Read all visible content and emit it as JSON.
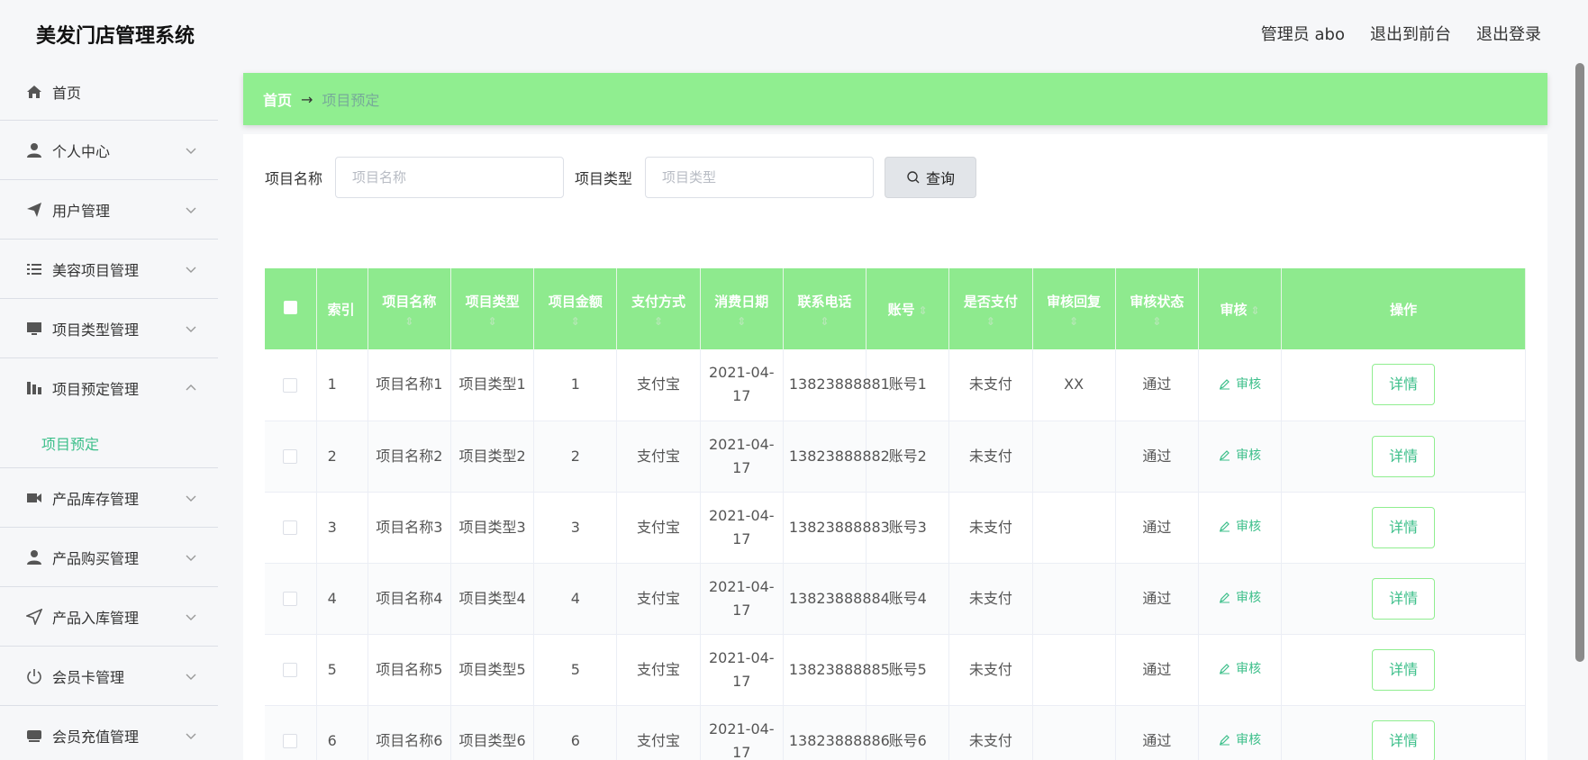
{
  "header": {
    "brand": "美发门店管理系统",
    "admin": "管理员 abo",
    "to_front": "退出到前台",
    "logout": "退出登录"
  },
  "sidebar": {
    "items": [
      {
        "label": "首页",
        "icon": "home-icon"
      },
      {
        "label": "个人中心",
        "icon": "user-icon"
      },
      {
        "label": "用户管理",
        "icon": "paper-plane-icon"
      },
      {
        "label": "美容项目管理",
        "icon": "list-icon"
      },
      {
        "label": "项目类型管理",
        "icon": "monitor-icon"
      },
      {
        "label": "项目预定管理",
        "icon": "chart-icon"
      },
      {
        "label": "产品库存管理",
        "icon": "video-icon"
      },
      {
        "label": "产品购买管理",
        "icon": "user-icon"
      },
      {
        "label": "产品入库管理",
        "icon": "send-icon"
      },
      {
        "label": "会员卡管理",
        "icon": "power-icon"
      },
      {
        "label": "会员充值管理",
        "icon": "card-icon"
      }
    ],
    "submenu_label": "项目预定"
  },
  "breadcrumb": {
    "home": "首页",
    "current": "项目预定"
  },
  "search": {
    "name_label": "项目名称",
    "name_placeholder": "项目名称",
    "type_label": "项目类型",
    "type_placeholder": "项目类型",
    "button": "查询"
  },
  "table": {
    "headers": [
      "索引",
      "项目名称",
      "项目类型",
      "项目金额",
      "支付方式",
      "消费日期",
      "联系电话",
      "账号",
      "是否支付",
      "审核回复",
      "审核状态",
      "审核",
      "操作"
    ],
    "audit_label": "审核",
    "detail_label": "详情",
    "rows": [
      {
        "index": "1",
        "name": "项目名称1",
        "type": "项目类型1",
        "amount": "1",
        "pay": "支付宝",
        "date": "2021-04-17",
        "phone": "13823888881",
        "account": "账号1",
        "paid": "未支付",
        "reply": "XX",
        "status": "通过"
      },
      {
        "index": "2",
        "name": "项目名称2",
        "type": "项目类型2",
        "amount": "2",
        "pay": "支付宝",
        "date": "2021-04-17",
        "phone": "13823888882",
        "account": "账号2",
        "paid": "未支付",
        "reply": "",
        "status": "通过"
      },
      {
        "index": "3",
        "name": "项目名称3",
        "type": "项目类型3",
        "amount": "3",
        "pay": "支付宝",
        "date": "2021-04-17",
        "phone": "13823888883",
        "account": "账号3",
        "paid": "未支付",
        "reply": "",
        "status": "通过"
      },
      {
        "index": "4",
        "name": "项目名称4",
        "type": "项目类型4",
        "amount": "4",
        "pay": "支付宝",
        "date": "2021-04-17",
        "phone": "13823888884",
        "account": "账号4",
        "paid": "未支付",
        "reply": "",
        "status": "通过"
      },
      {
        "index": "5",
        "name": "项目名称5",
        "type": "项目类型5",
        "amount": "5",
        "pay": "支付宝",
        "date": "2021-04-17",
        "phone": "13823888885",
        "account": "账号5",
        "paid": "未支付",
        "reply": "",
        "status": "通过"
      },
      {
        "index": "6",
        "name": "项目名称6",
        "type": "项目类型6",
        "amount": "6",
        "pay": "支付宝",
        "date": "2021-04-17",
        "phone": "13823888886",
        "account": "账号6",
        "paid": "未支付",
        "reply": "",
        "status": "通过"
      }
    ]
  },
  "colors": {
    "accent_green": "#90ee90",
    "link_green": "#3cbf8a"
  }
}
